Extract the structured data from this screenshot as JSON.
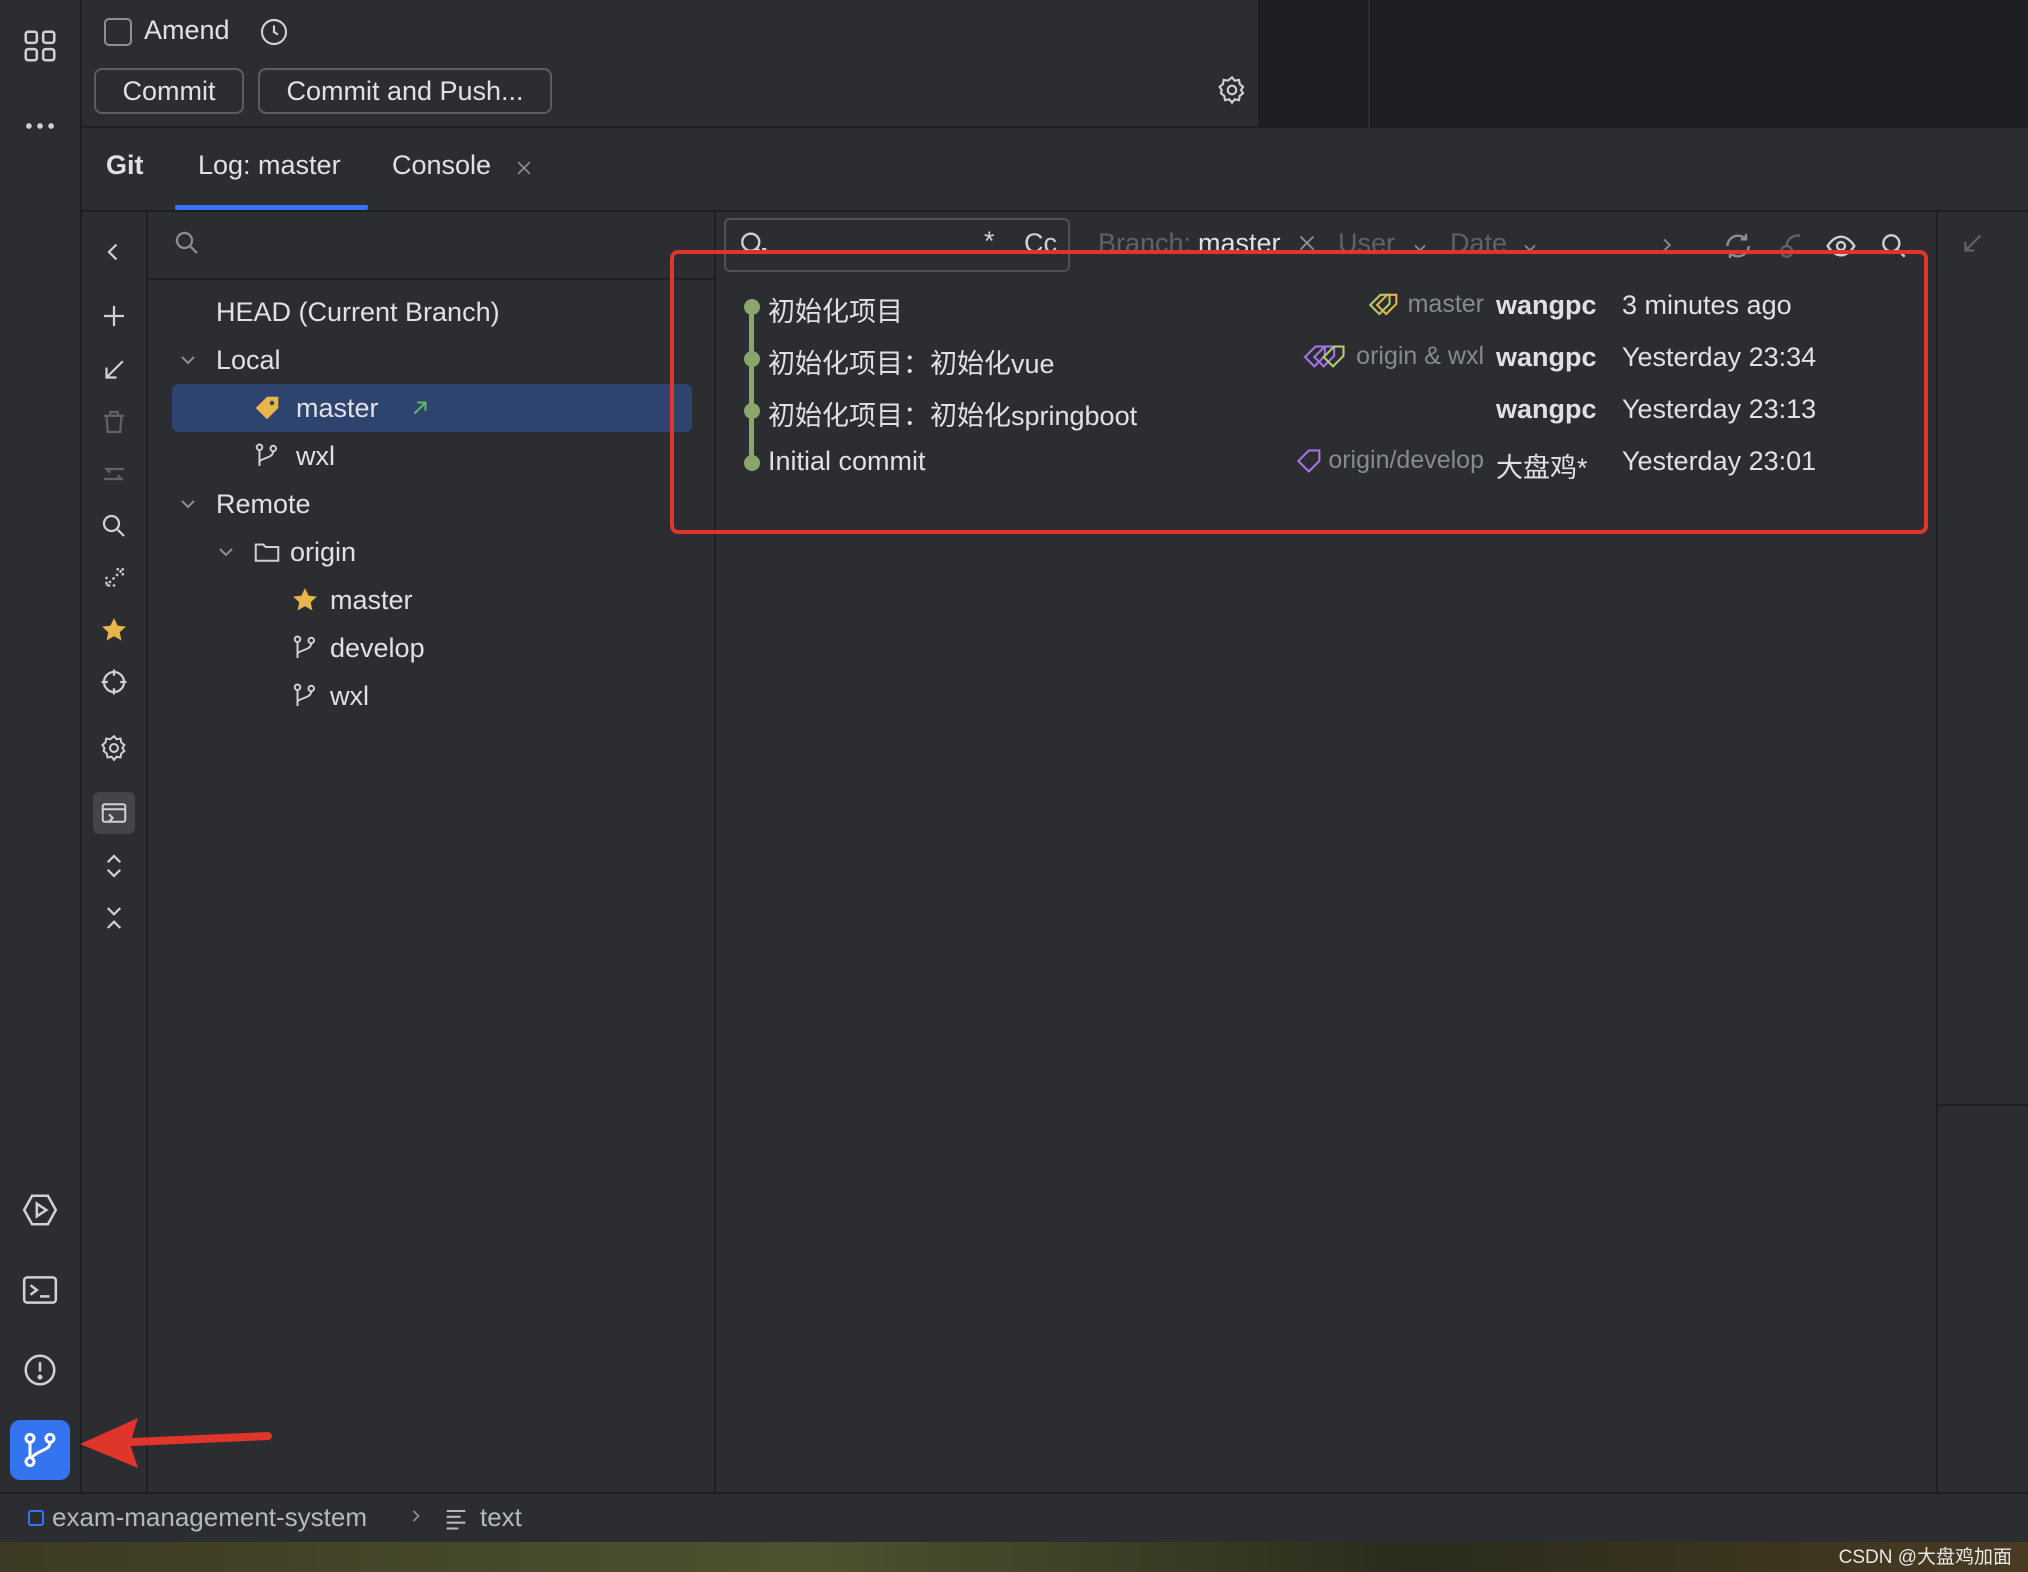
{
  "commit_panel": {
    "amend_label": "Amend",
    "commit_button": "Commit",
    "commit_push_button": "Commit and Push..."
  },
  "tabs": {
    "git": "Git",
    "log": "Log: master",
    "console": "Console"
  },
  "branch_tree": {
    "head": "HEAD (Current Branch)",
    "local_label": "Local",
    "local_branches": [
      "master",
      "wxl"
    ],
    "remote_label": "Remote",
    "remote_name": "origin",
    "remote_branches": [
      "master",
      "develop",
      "wxl"
    ]
  },
  "log_toolbar": {
    "regex_toggle": "*",
    "case_toggle": "Cc",
    "branch_filter_label": "Branch:",
    "branch_filter_value": "master",
    "user_filter": "User",
    "date_filter": "Date"
  },
  "commits": [
    {
      "message": "初始化项目",
      "refs": "master",
      "author": "wangpc",
      "date": "3 minutes ago"
    },
    {
      "message": "初始化项目：初始化vue",
      "refs": "origin & wxl",
      "author": "wangpc",
      "date": "Yesterday 23:34"
    },
    {
      "message": "初始化项目：初始化springboot",
      "refs": "",
      "author": "wangpc",
      "date": "Yesterday 23:13"
    },
    {
      "message": "Initial commit",
      "refs": "origin/develop",
      "author": "大盘鸡*",
      "date": "Yesterday 23:01"
    }
  ],
  "status_bar": {
    "project": "exam-management-system",
    "file": "text"
  },
  "watermark": "CSDN @大盘鸡加面",
  "colors": {
    "accent": "#3574f0",
    "selection": "#2e436e",
    "graph": "#8aa66c",
    "annotation_red": "#e0352b",
    "tag_yellow": "#e8b54a"
  }
}
